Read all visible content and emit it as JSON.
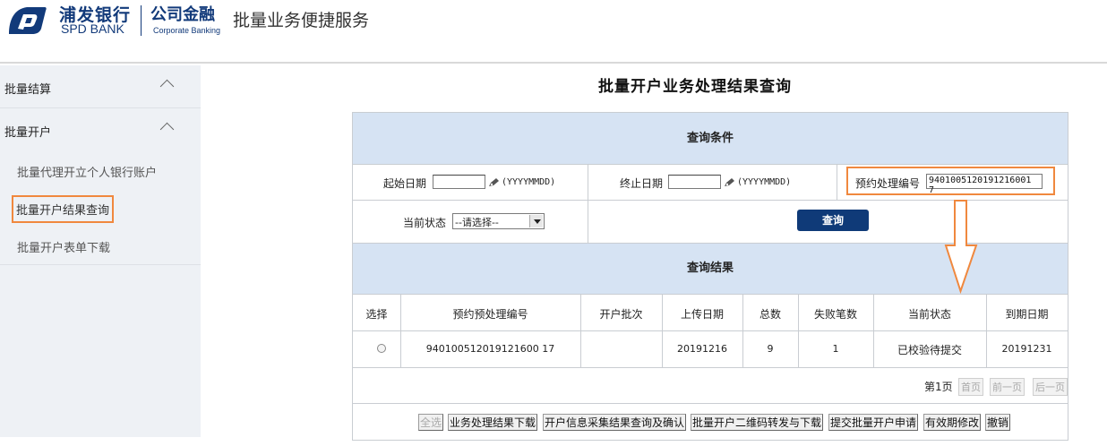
{
  "header": {
    "bank_cn": "浦发银行",
    "bank_en": "SPD BANK",
    "corp_cn": "公司金融",
    "corp_en": "Corporate Banking",
    "app_title": "批量业务便捷服务",
    "brand_color": "#123a7a"
  },
  "sidebar": {
    "groups": [
      {
        "label": "批量结算",
        "icon": "chevron-up-icon"
      },
      {
        "label": "批量开户",
        "icon": "chevron-up-icon"
      }
    ],
    "items": [
      {
        "label": "批量代理开立个人银行账户"
      },
      {
        "label": "批量开户结果查询",
        "active": true
      },
      {
        "label": "批量开户表单下载"
      }
    ]
  },
  "page": {
    "title": "批量开户业务处理结果查询"
  },
  "query": {
    "section_title": "查询条件",
    "start_date_label": "起始日期",
    "start_date_value": "",
    "end_date_label": "终止日期",
    "end_date_value": "",
    "date_format": "(YYYYMMDD)",
    "reserve_no_label": "预约处理编号",
    "reserve_no_value": "9401005120191216001 7",
    "status_label": "当前状态",
    "status_selected": "--请选择--",
    "query_button": "查询",
    "highlight_color": "#f0883e"
  },
  "results": {
    "section_title": "查询结果",
    "columns": [
      "选择",
      "预约预处理编号",
      "开户批次",
      "上传日期",
      "总数",
      "失败笔数",
      "当前状态",
      "到期日期"
    ],
    "rows": [
      {
        "reserve_no": "940100512019121600 17",
        "batch": "",
        "upload_date": "20191216",
        "total": "9",
        "failed": "1",
        "status": "已校验待提交",
        "expire_date": "20191231"
      }
    ]
  },
  "pagination": {
    "page_text": "第1页",
    "first": "首页",
    "prev": "前一页",
    "next": "后一页"
  },
  "actions": {
    "select_all": "全选",
    "download_result": "业务处理结果下载",
    "info_confirm": "开户信息采集结果查询及确认",
    "qr_forward": "批量开户二维码转发与下载",
    "submit": "提交批量开户申请",
    "validity": "有效期修改",
    "revoke": "撤销"
  }
}
